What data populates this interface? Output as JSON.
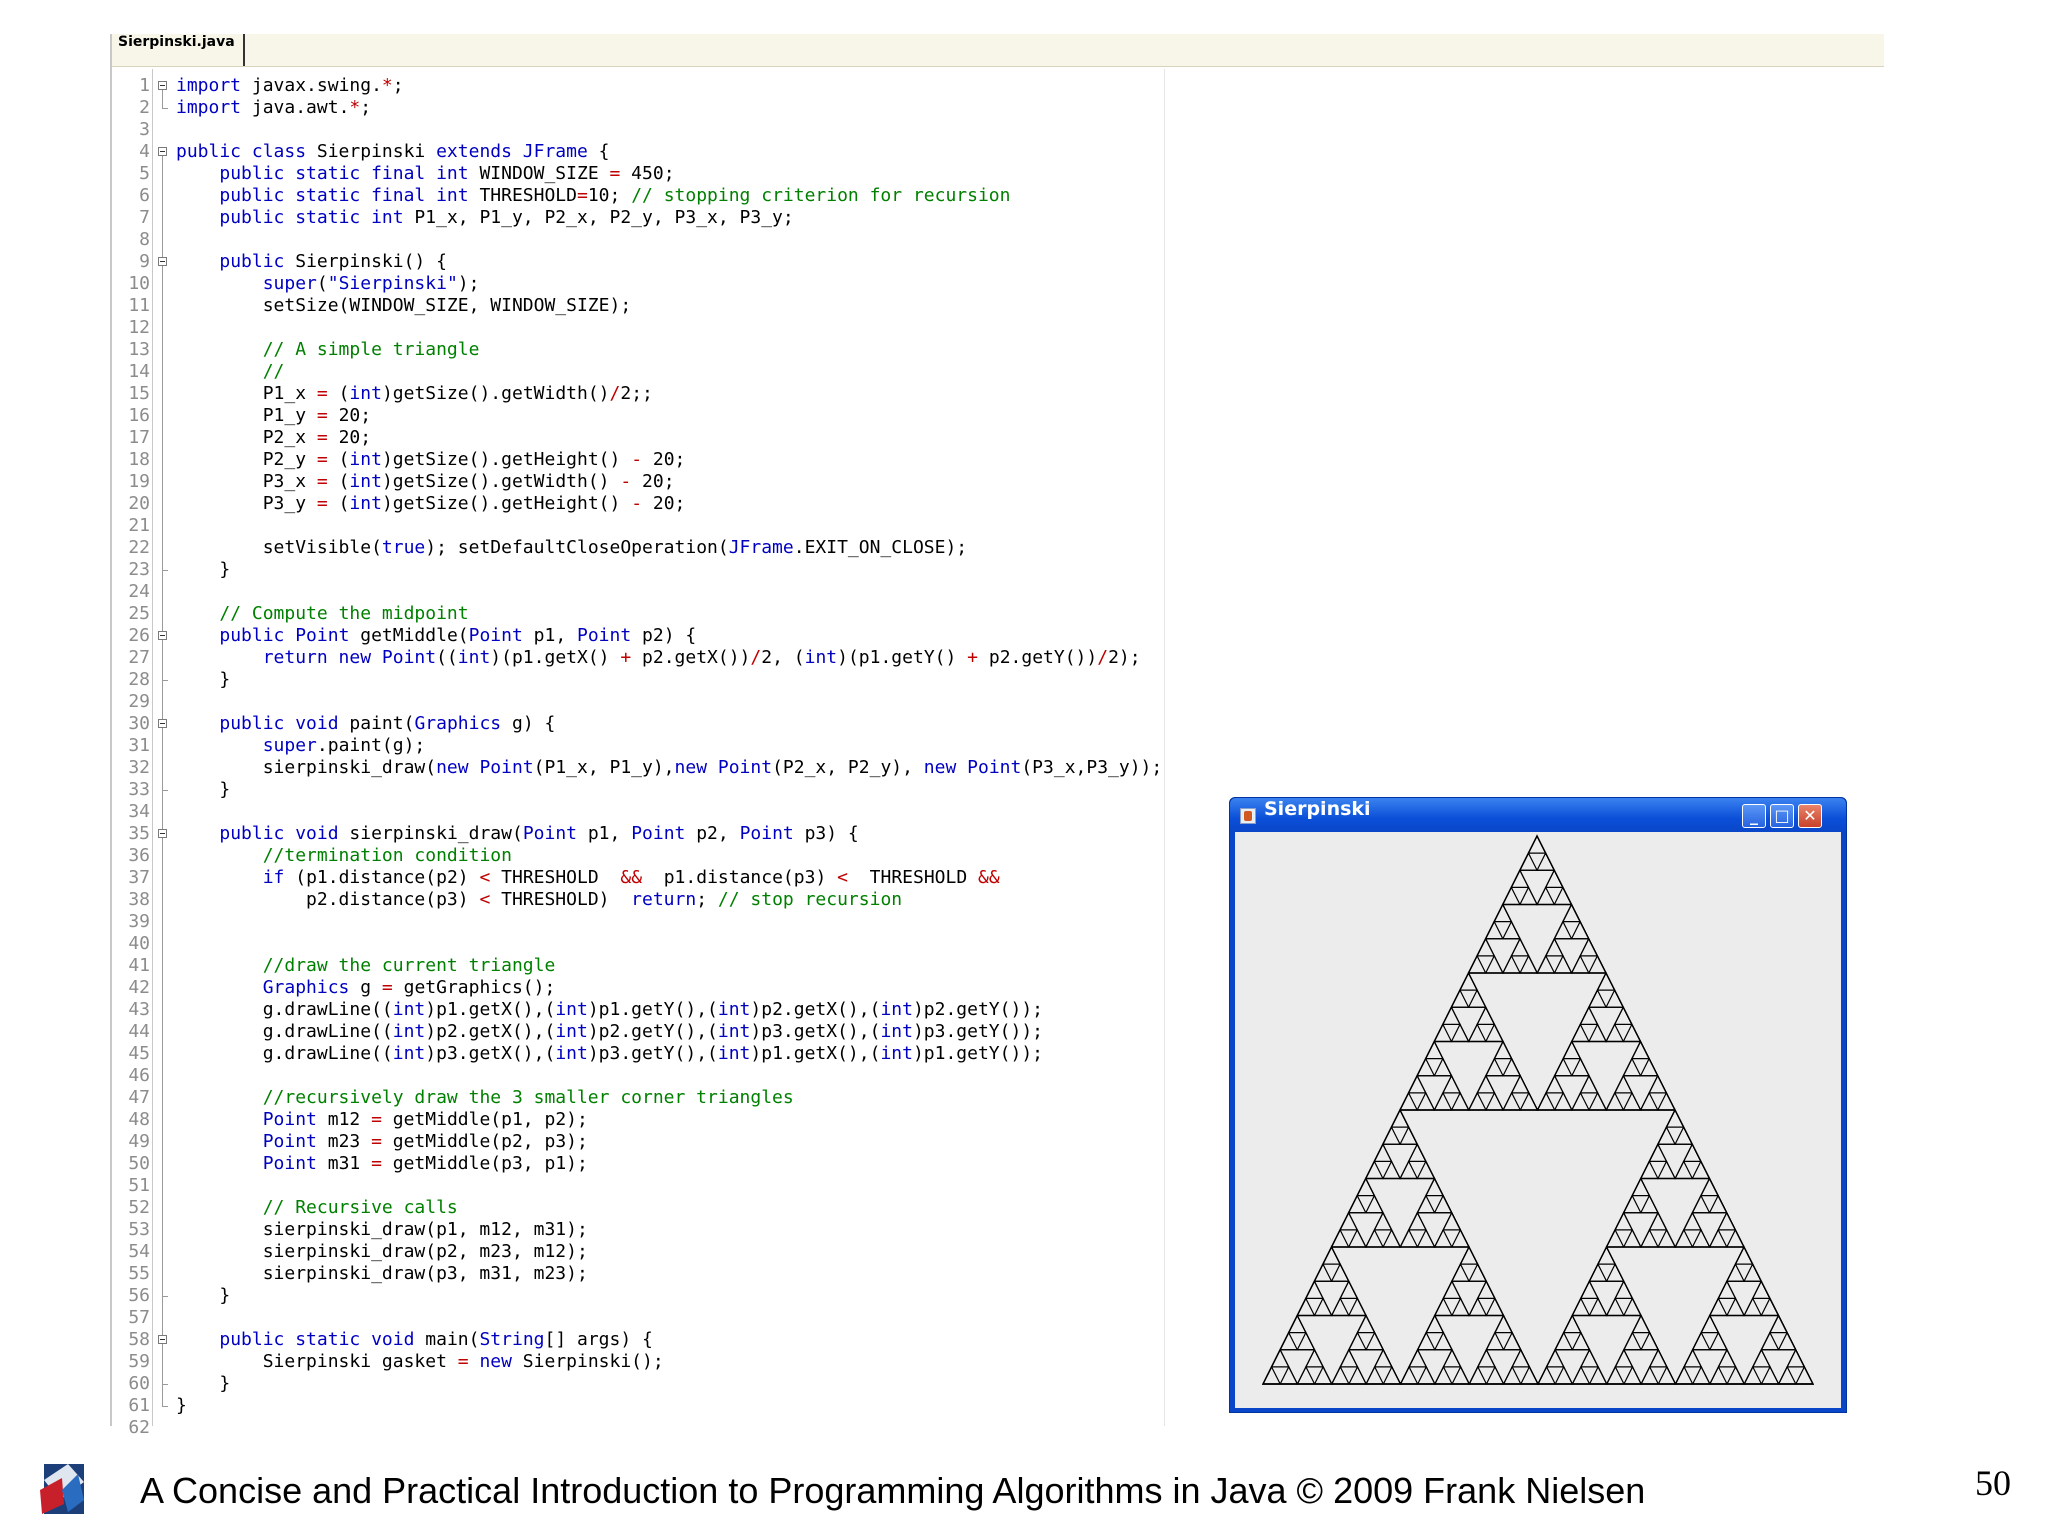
{
  "editor": {
    "tab_label": "Sierpinski.java",
    "partial_last_line_number": "62",
    "lines": [
      [
        [
          "kw",
          "import"
        ],
        [
          "t",
          " javax.swing."
        ],
        [
          "op",
          "*"
        ],
        [
          "t",
          ";"
        ]
      ],
      [
        [
          "kw",
          "import"
        ],
        [
          "t",
          " java.awt."
        ],
        [
          "op",
          "*"
        ],
        [
          "t",
          ";"
        ]
      ],
      [],
      [
        [
          "kw",
          "public class"
        ],
        [
          "t",
          " Sierpinski "
        ],
        [
          "kw",
          "extends JFrame"
        ],
        [
          "t",
          " {"
        ]
      ],
      [
        [
          "t",
          "    "
        ],
        [
          "kw",
          "public static final int"
        ],
        [
          "t",
          " WINDOW_SIZE "
        ],
        [
          "op",
          "="
        ],
        [
          "t",
          " 450;"
        ]
      ],
      [
        [
          "t",
          "    "
        ],
        [
          "kw",
          "public static final int"
        ],
        [
          "t",
          " THRESHOLD"
        ],
        [
          "op",
          "="
        ],
        [
          "t",
          "10; "
        ],
        [
          "cm",
          "// stopping criterion for recursion"
        ]
      ],
      [
        [
          "t",
          "    "
        ],
        [
          "kw",
          "public static int"
        ],
        [
          "t",
          " P1_x, P1_y, P2_x, P2_y, P3_x, P3_y;"
        ]
      ],
      [],
      [
        [
          "t",
          "    "
        ],
        [
          "kw",
          "public"
        ],
        [
          "t",
          " Sierpinski() {"
        ]
      ],
      [
        [
          "t",
          "        "
        ],
        [
          "kw",
          "super"
        ],
        [
          "t",
          "("
        ],
        [
          "kw",
          "\"Sierpinski\""
        ],
        [
          "t",
          ");"
        ]
      ],
      [
        [
          "t",
          "        setSize(WINDOW_SIZE, WINDOW_SIZE);"
        ]
      ],
      [],
      [
        [
          "t",
          "        "
        ],
        [
          "cm",
          "// A simple triangle"
        ]
      ],
      [
        [
          "t",
          "        "
        ],
        [
          "cm",
          "//"
        ]
      ],
      [
        [
          "t",
          "        P1_x "
        ],
        [
          "op",
          "="
        ],
        [
          "t",
          " ("
        ],
        [
          "kw",
          "int"
        ],
        [
          "t",
          ")getSize().getWidth()"
        ],
        [
          "op",
          "/"
        ],
        [
          "t",
          "2;;"
        ]
      ],
      [
        [
          "t",
          "        P1_y "
        ],
        [
          "op",
          "="
        ],
        [
          "t",
          " 20;"
        ]
      ],
      [
        [
          "t",
          "        P2_x "
        ],
        [
          "op",
          "="
        ],
        [
          "t",
          " 20;"
        ]
      ],
      [
        [
          "t",
          "        P2_y "
        ],
        [
          "op",
          "="
        ],
        [
          "t",
          " ("
        ],
        [
          "kw",
          "int"
        ],
        [
          "t",
          ")getSize().getHeight() "
        ],
        [
          "op",
          "-"
        ],
        [
          "t",
          " 20;"
        ]
      ],
      [
        [
          "t",
          "        P3_x "
        ],
        [
          "op",
          "="
        ],
        [
          "t",
          " ("
        ],
        [
          "kw",
          "int"
        ],
        [
          "t",
          ")getSize().getWidth() "
        ],
        [
          "op",
          "-"
        ],
        [
          "t",
          " 20;"
        ]
      ],
      [
        [
          "t",
          "        P3_y "
        ],
        [
          "op",
          "="
        ],
        [
          "t",
          " ("
        ],
        [
          "kw",
          "int"
        ],
        [
          "t",
          ")getSize().getHeight() "
        ],
        [
          "op",
          "-"
        ],
        [
          "t",
          " 20;"
        ]
      ],
      [],
      [
        [
          "t",
          "        setVisible("
        ],
        [
          "kw",
          "true"
        ],
        [
          "t",
          "); setDefaultCloseOperation("
        ],
        [
          "kw",
          "JFrame"
        ],
        [
          "t",
          ".EXIT_ON_CLOSE);"
        ]
      ],
      [
        [
          "t",
          "    }"
        ]
      ],
      [],
      [
        [
          "t",
          "    "
        ],
        [
          "cm",
          "// Compute the midpoint"
        ]
      ],
      [
        [
          "t",
          "    "
        ],
        [
          "kw",
          "public Point"
        ],
        [
          "t",
          " getMiddle("
        ],
        [
          "kw",
          "Point"
        ],
        [
          "t",
          " p1, "
        ],
        [
          "kw",
          "Point"
        ],
        [
          "t",
          " p2) {"
        ]
      ],
      [
        [
          "t",
          "        "
        ],
        [
          "kw",
          "return new Point"
        ],
        [
          "t",
          "(("
        ],
        [
          "kw",
          "int"
        ],
        [
          "t",
          ")(p1.getX() "
        ],
        [
          "op",
          "+"
        ],
        [
          "t",
          " p2.getX())"
        ],
        [
          "op",
          "/"
        ],
        [
          "t",
          "2, ("
        ],
        [
          "kw",
          "int"
        ],
        [
          "t",
          ")(p1.getY() "
        ],
        [
          "op",
          "+"
        ],
        [
          "t",
          " p2.getY())"
        ],
        [
          "op",
          "/"
        ],
        [
          "t",
          "2);"
        ]
      ],
      [
        [
          "t",
          "    }"
        ]
      ],
      [],
      [
        [
          "t",
          "    "
        ],
        [
          "kw",
          "public void"
        ],
        [
          "t",
          " paint("
        ],
        [
          "kw",
          "Graphics"
        ],
        [
          "t",
          " g) {"
        ]
      ],
      [
        [
          "t",
          "        "
        ],
        [
          "kw",
          "super"
        ],
        [
          "t",
          ".paint(g);"
        ]
      ],
      [
        [
          "t",
          "        sierpinski_draw("
        ],
        [
          "kw",
          "new Point"
        ],
        [
          "t",
          "(P1_x, P1_y),"
        ],
        [
          "kw",
          "new Point"
        ],
        [
          "t",
          "(P2_x, P2_y), "
        ],
        [
          "kw",
          "new Point"
        ],
        [
          "t",
          "(P3_x,P3_y));"
        ]
      ],
      [
        [
          "t",
          "    }"
        ]
      ],
      [],
      [
        [
          "t",
          "    "
        ],
        [
          "kw",
          "public void"
        ],
        [
          "t",
          " sierpinski_draw("
        ],
        [
          "kw",
          "Point"
        ],
        [
          "t",
          " p1, "
        ],
        [
          "kw",
          "Point"
        ],
        [
          "t",
          " p2, "
        ],
        [
          "kw",
          "Point"
        ],
        [
          "t",
          " p3) {"
        ]
      ],
      [
        [
          "t",
          "        "
        ],
        [
          "cm",
          "//termination condition"
        ]
      ],
      [
        [
          "t",
          "        "
        ],
        [
          "kw",
          "if"
        ],
        [
          "t",
          " (p1.distance(p2) "
        ],
        [
          "op",
          "<"
        ],
        [
          "t",
          " THRESHOLD  "
        ],
        [
          "op",
          "&&"
        ],
        [
          "t",
          "  p1.distance(p3) "
        ],
        [
          "op",
          "<"
        ],
        [
          "t",
          "  THRESHOLD "
        ],
        [
          "op",
          "&&"
        ]
      ],
      [
        [
          "t",
          "            p2.distance(p3) "
        ],
        [
          "op",
          "<"
        ],
        [
          "t",
          " THRESHOLD)  "
        ],
        [
          "kw",
          "return"
        ],
        [
          "t",
          "; "
        ],
        [
          "cm",
          "// stop recursion"
        ]
      ],
      [],
      [],
      [
        [
          "t",
          "        "
        ],
        [
          "cm",
          "//draw the current triangle"
        ]
      ],
      [
        [
          "t",
          "        "
        ],
        [
          "kw",
          "Graphics"
        ],
        [
          "t",
          " g "
        ],
        [
          "op",
          "="
        ],
        [
          "t",
          " getGraphics();"
        ]
      ],
      [
        [
          "t",
          "        g.drawLine(("
        ],
        [
          "kw",
          "int"
        ],
        [
          "t",
          ")p1.getX(),("
        ],
        [
          "kw",
          "int"
        ],
        [
          "t",
          ")p1.getY(),("
        ],
        [
          "kw",
          "int"
        ],
        [
          "t",
          ")p2.getX(),("
        ],
        [
          "kw",
          "int"
        ],
        [
          "t",
          ")p2.getY());"
        ]
      ],
      [
        [
          "t",
          "        g.drawLine(("
        ],
        [
          "kw",
          "int"
        ],
        [
          "t",
          ")p2.getX(),("
        ],
        [
          "kw",
          "int"
        ],
        [
          "t",
          ")p2.getY(),("
        ],
        [
          "kw",
          "int"
        ],
        [
          "t",
          ")p3.getX(),("
        ],
        [
          "kw",
          "int"
        ],
        [
          "t",
          ")p3.getY());"
        ]
      ],
      [
        [
          "t",
          "        g.drawLine(("
        ],
        [
          "kw",
          "int"
        ],
        [
          "t",
          ")p3.getX(),("
        ],
        [
          "kw",
          "int"
        ],
        [
          "t",
          ")p3.getY(),("
        ],
        [
          "kw",
          "int"
        ],
        [
          "t",
          ")p1.getX(),("
        ],
        [
          "kw",
          "int"
        ],
        [
          "t",
          ")p1.getY());"
        ]
      ],
      [],
      [
        [
          "t",
          "        "
        ],
        [
          "cm",
          "//recursively draw the 3 smaller corner triangles"
        ]
      ],
      [
        [
          "t",
          "        "
        ],
        [
          "kw",
          "Point"
        ],
        [
          "t",
          " m12 "
        ],
        [
          "op",
          "="
        ],
        [
          "t",
          " getMiddle(p1, p2);"
        ]
      ],
      [
        [
          "t",
          "        "
        ],
        [
          "kw",
          "Point"
        ],
        [
          "t",
          " m23 "
        ],
        [
          "op",
          "="
        ],
        [
          "t",
          " getMiddle(p2, p3);"
        ]
      ],
      [
        [
          "t",
          "        "
        ],
        [
          "kw",
          "Point"
        ],
        [
          "t",
          " m31 "
        ],
        [
          "op",
          "="
        ],
        [
          "t",
          " getMiddle(p3, p1);"
        ]
      ],
      [],
      [
        [
          "t",
          "        "
        ],
        [
          "cm",
          "// Recursive calls"
        ]
      ],
      [
        [
          "t",
          "        sierpinski_draw(p1, m12, m31);"
        ]
      ],
      [
        [
          "t",
          "        sierpinski_draw(p2, m23, m12);"
        ]
      ],
      [
        [
          "t",
          "        sierpinski_draw(p3, m31, m23);"
        ]
      ],
      [
        [
          "t",
          "    }"
        ]
      ],
      [],
      [
        [
          "t",
          "    "
        ],
        [
          "kw",
          "public static void"
        ],
        [
          "t",
          " main("
        ],
        [
          "kw",
          "String"
        ],
        [
          "t",
          "[] args) {"
        ]
      ],
      [
        [
          "t",
          "        Sierpinski gasket "
        ],
        [
          "op",
          "="
        ],
        [
          "t",
          " "
        ],
        [
          "kw",
          "new"
        ],
        [
          "t",
          " Sierpinski();"
        ]
      ],
      [
        [
          "t",
          "    }"
        ]
      ],
      [
        [
          "t",
          "}"
        ]
      ]
    ]
  },
  "window": {
    "title": "Sierpinski",
    "minimize_glyph": "_",
    "maximize_glyph": "□",
    "close_glyph": "✕",
    "recursion_depth": 5
  },
  "footer": {
    "text": "A Concise and Practical Introduction to Programming Algorithms in Java © 2009 Frank Nielsen",
    "page_number": "50"
  }
}
